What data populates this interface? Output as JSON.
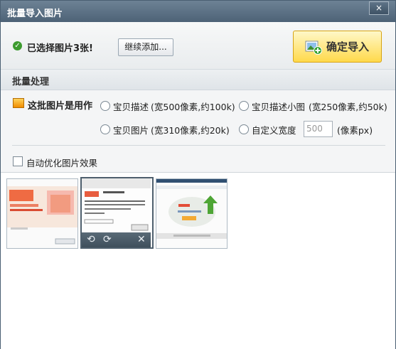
{
  "window": {
    "title": "批量导入图片",
    "close": "×"
  },
  "top": {
    "selected": "已选择图片3张!",
    "continue_add": "继续添加...",
    "confirm_import": "确定导入"
  },
  "batch": {
    "section_title": "批量处理",
    "use_label": "这批图片是用作",
    "options": [
      {
        "label": "宝贝描述",
        "hint": "(宽500像素,约100k)"
      },
      {
        "label": "宝贝描述小图",
        "hint": "(宽250像素,约50k)"
      },
      {
        "label": "宝贝图片",
        "hint": "(宽310像素,约20k)"
      },
      {
        "label": "自定义宽度",
        "hint": ""
      }
    ],
    "custom_width_value": "500",
    "custom_width_unit": "(像素px)",
    "auto_optimize": "自动优化图片效果"
  },
  "thumbs": {
    "toolbar_icons": [
      "rotate-left-icon",
      "rotate-right-icon",
      "delete-icon"
    ],
    "toolbar_glyphs": [
      "⟲",
      "⟳",
      "✕"
    ]
  }
}
